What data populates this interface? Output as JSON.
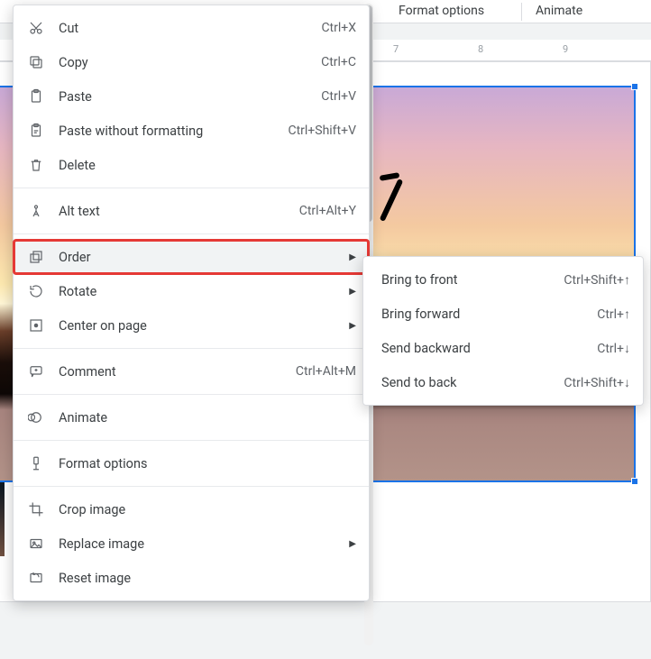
{
  "toolbar": {
    "format_options": "Format options",
    "animate": "Animate"
  },
  "ruler": {
    "ticks": [
      "7",
      "8",
      "9"
    ]
  },
  "context_menu": {
    "groups": [
      [
        {
          "icon": "cut-icon",
          "label": "Cut",
          "shortcut": "Ctrl+X"
        },
        {
          "icon": "copy-icon",
          "label": "Copy",
          "shortcut": "Ctrl+C"
        },
        {
          "icon": "paste-icon",
          "label": "Paste",
          "shortcut": "Ctrl+V"
        },
        {
          "icon": "paste-plain-icon",
          "label": "Paste without formatting",
          "shortcut": "Ctrl+Shift+V"
        },
        {
          "icon": "delete-icon",
          "label": "Delete"
        }
      ],
      [
        {
          "icon": "alt-text-icon",
          "label": "Alt text",
          "shortcut": "Ctrl+Alt+Y"
        }
      ],
      [
        {
          "icon": "order-icon",
          "label": "Order",
          "submenu": true,
          "highlighted": true
        },
        {
          "icon": "rotate-icon",
          "label": "Rotate",
          "submenu": true
        },
        {
          "icon": "center-icon",
          "label": "Center on page",
          "submenu": true
        }
      ],
      [
        {
          "icon": "comment-icon",
          "label": "Comment",
          "shortcut": "Ctrl+Alt+M"
        }
      ],
      [
        {
          "icon": "animate-icon",
          "label": "Animate"
        }
      ],
      [
        {
          "icon": "format-opts-icon",
          "label": "Format options"
        }
      ],
      [
        {
          "icon": "crop-icon",
          "label": "Crop image"
        },
        {
          "icon": "replace-img-icon",
          "label": "Replace image",
          "submenu": true
        },
        {
          "icon": "reset-img-icon",
          "label": "Reset image"
        }
      ]
    ]
  },
  "order_submenu": [
    {
      "label": "Bring to front",
      "shortcut": "Ctrl+Shift+↑"
    },
    {
      "label": "Bring forward",
      "shortcut": "Ctrl+↑"
    },
    {
      "label": "Send backward",
      "shortcut": "Ctrl+↓"
    },
    {
      "label": "Send to back",
      "shortcut": "Ctrl+Shift+↓"
    }
  ]
}
